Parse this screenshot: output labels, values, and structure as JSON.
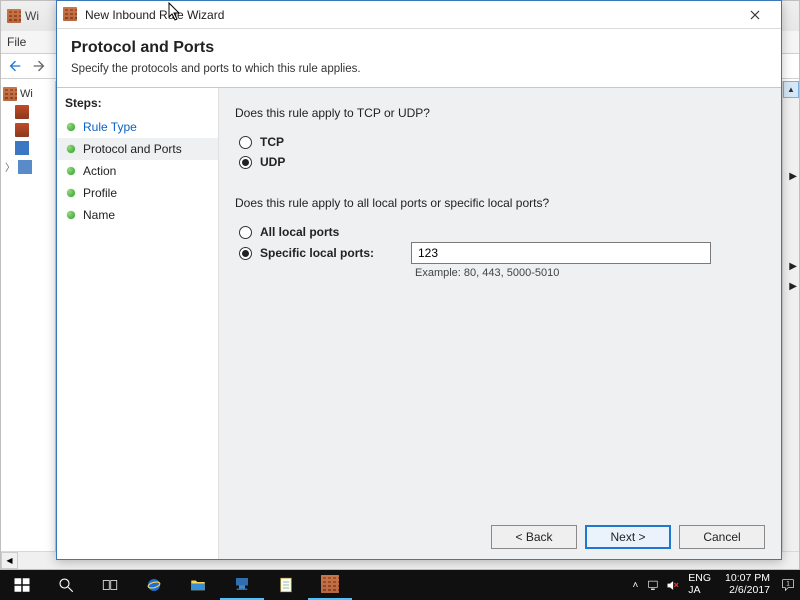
{
  "background": {
    "title_prefix": "Wi",
    "menu": {
      "file": "File"
    },
    "tree": {
      "root": "Wi"
    }
  },
  "dialog": {
    "title": "New Inbound Rule Wizard",
    "header": "Protocol and Ports",
    "subheader": "Specify the protocols and ports to which this rule applies.",
    "steps_header": "Steps:",
    "steps": [
      {
        "label": "Rule Type",
        "link": true
      },
      {
        "label": "Protocol and Ports",
        "active": true
      },
      {
        "label": "Action"
      },
      {
        "label": "Profile"
      },
      {
        "label": "Name"
      }
    ],
    "question_protocol": "Does this rule apply to TCP or UDP?",
    "protocol_options": {
      "tcp": "TCP",
      "udp": "UDP",
      "selected": "udp"
    },
    "question_ports": "Does this rule apply to all local ports or specific local ports?",
    "port_options": {
      "all": "All local ports",
      "specific": "Specific local ports:",
      "selected": "specific",
      "value": "123",
      "example": "Example: 80, 443, 5000-5010"
    },
    "buttons": {
      "back": "< Back",
      "next": "Next >",
      "cancel": "Cancel"
    }
  },
  "taskbar": {
    "lang1": "ENG",
    "lang2": "JA",
    "time": "10:07 PM",
    "date": "2/6/2017"
  }
}
